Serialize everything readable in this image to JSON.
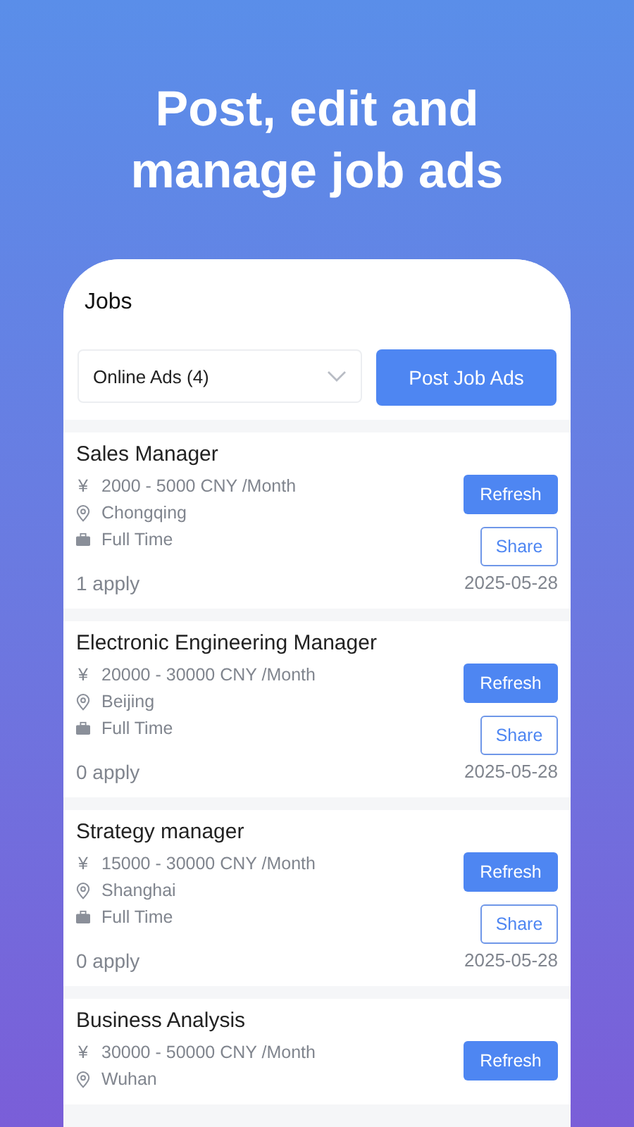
{
  "headline": "Post, edit and manage job ads",
  "screen_title": "Jobs",
  "filter": {
    "value": "Online Ads (4)"
  },
  "post_button": "Post Job Ads",
  "jobs": [
    {
      "title": "Sales Manager",
      "salary": "2000 - 5000 CNY /Month",
      "currency": "¥",
      "location": "Chongqing",
      "type": "Full Time",
      "refresh": "Refresh",
      "share": "Share",
      "applies": "1 apply",
      "date": "2025-05-28"
    },
    {
      "title": "Electronic Engineering Manager",
      "salary": "20000 - 30000 CNY /Month",
      "currency": "¥",
      "location": "Beijing",
      "type": "Full Time",
      "refresh": "Refresh",
      "share": "Share",
      "applies": "0 apply",
      "date": "2025-05-28"
    },
    {
      "title": "Strategy manager",
      "salary": "15000 - 30000 CNY /Month",
      "currency": "¥",
      "location": "Shanghai",
      "type": "Full Time",
      "refresh": "Refresh",
      "share": "Share",
      "applies": "0 apply",
      "date": "2025-05-28"
    },
    {
      "title": "Business Analysis",
      "salary": "30000 - 50000 CNY /Month",
      "currency": "¥",
      "location": "Wuhan",
      "refresh": "Refresh"
    }
  ]
}
